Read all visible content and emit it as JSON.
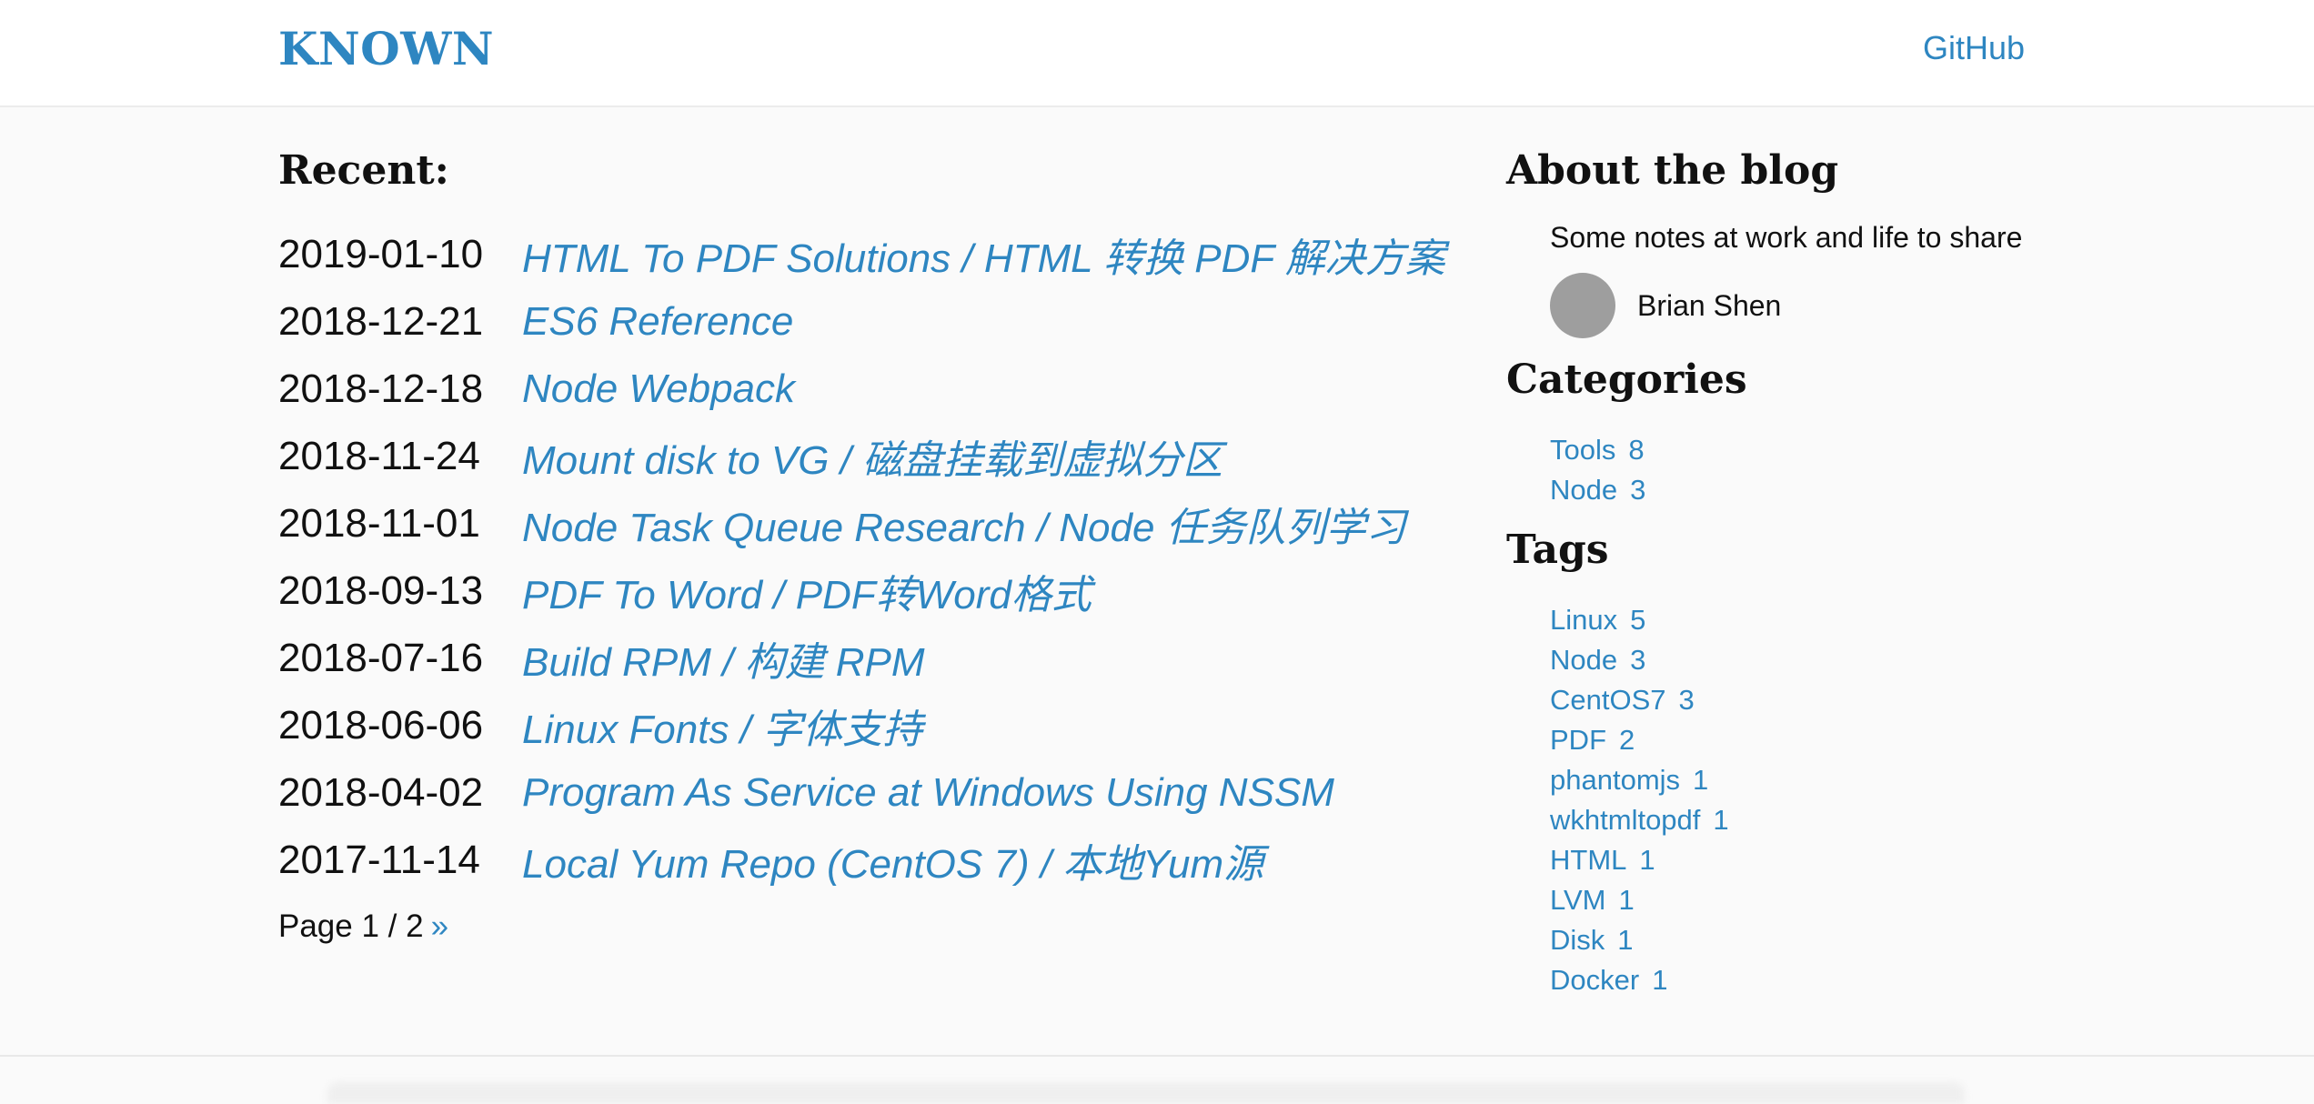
{
  "header": {
    "brand": "KNOWN",
    "nav_github": "GitHub"
  },
  "main": {
    "title": "Recent:",
    "posts": [
      {
        "date": "2019-01-10",
        "title": "HTML To PDF Solutions / HTML 转换 PDF 解决方案"
      },
      {
        "date": "2018-12-21",
        "title": "ES6 Reference"
      },
      {
        "date": "2018-12-18",
        "title": "Node Webpack"
      },
      {
        "date": "2018-11-24",
        "title": "Mount disk to VG / 磁盘挂载到虚拟分区"
      },
      {
        "date": "2018-11-01",
        "title": "Node Task Queue Research / Node 任务队列学习"
      },
      {
        "date": "2018-09-13",
        "title": "PDF To Word / PDF转Word格式"
      },
      {
        "date": "2018-07-16",
        "title": "Build RPM / 构建 RPM"
      },
      {
        "date": "2018-06-06",
        "title": "Linux Fonts / 字体支持"
      },
      {
        "date": "2018-04-02",
        "title": "Program As Service at Windows Using NSSM"
      },
      {
        "date": "2017-11-14",
        "title": "Local Yum Repo (CentOS 7) / 本地Yum源"
      }
    ],
    "pager": {
      "text": "Page 1 / 2",
      "next": "»"
    }
  },
  "sidebar": {
    "about": {
      "title": "About the blog",
      "text": "Some notes at work and life to share",
      "author": "Brian Shen"
    },
    "categories": {
      "title": "Categories",
      "items": [
        {
          "name": "Tools",
          "count": "8"
        },
        {
          "name": "Node",
          "count": "3"
        }
      ]
    },
    "tags": {
      "title": "Tags",
      "items": [
        {
          "name": "Linux",
          "count": "5"
        },
        {
          "name": "Node",
          "count": "3"
        },
        {
          "name": "CentOS7",
          "count": "3"
        },
        {
          "name": "PDF",
          "count": "2"
        },
        {
          "name": "phantomjs",
          "count": "1"
        },
        {
          "name": "wkhtmltopdf",
          "count": "1"
        },
        {
          "name": "HTML",
          "count": "1"
        },
        {
          "name": "LVM",
          "count": "1"
        },
        {
          "name": "Disk",
          "count": "1"
        },
        {
          "name": "Docker",
          "count": "1"
        }
      ]
    }
  },
  "colors": {
    "accent": "#2e86c1",
    "text": "#111111",
    "background": "#fafafa",
    "avatar": "#9e9e9e"
  }
}
